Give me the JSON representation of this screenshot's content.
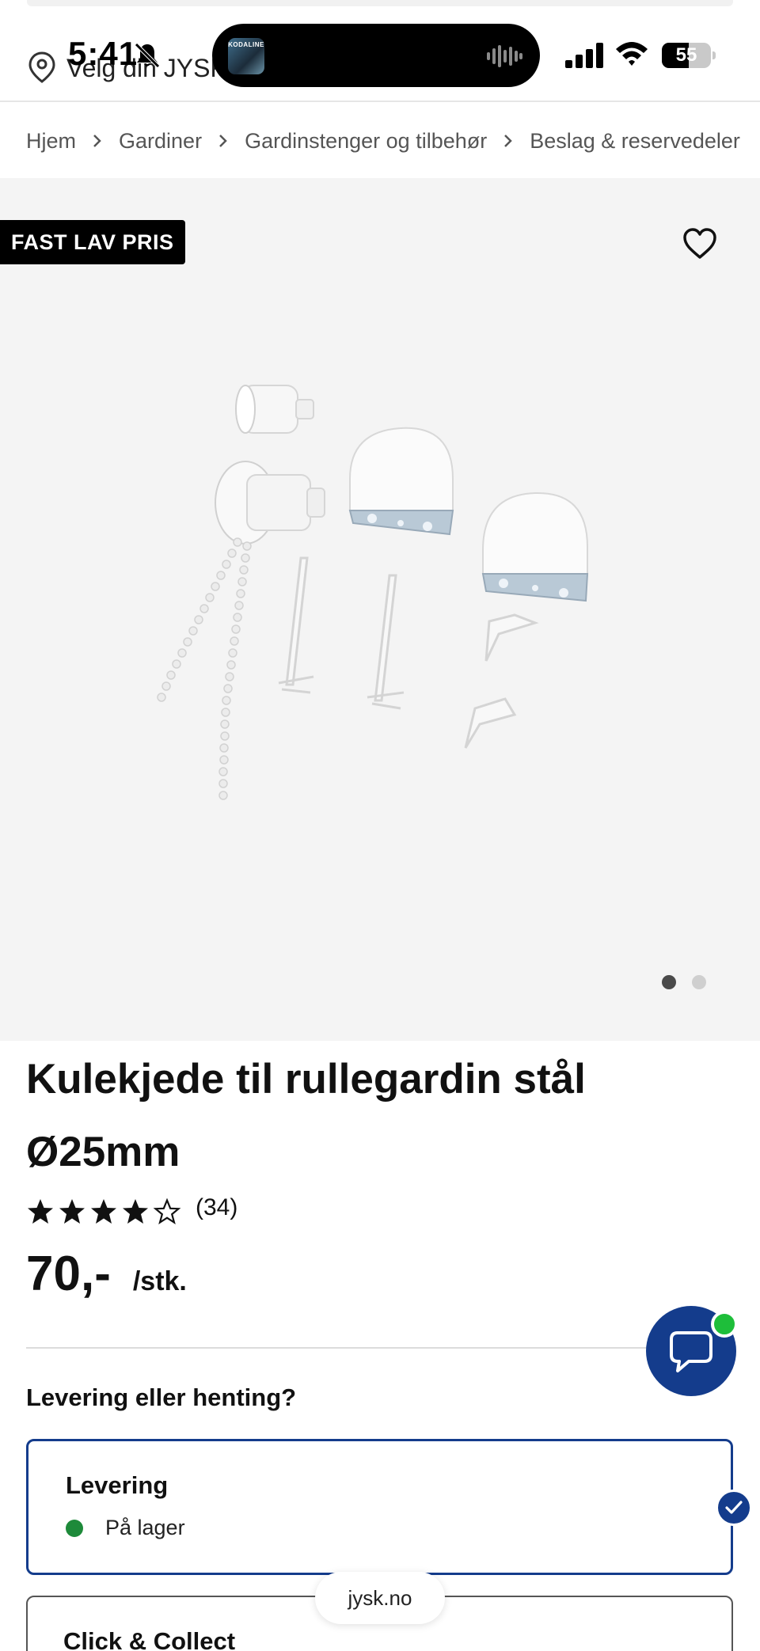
{
  "status_bar": {
    "time": "5:41",
    "battery": "55",
    "battery_level": 0.55,
    "now_playing_art_text": "KODALINE"
  },
  "header": {
    "location_text": "Velg din JYSK"
  },
  "breadcrumb": [
    "Hjem",
    "Gardiner",
    "Gardinstenger og tilbehør",
    "Beslag & reservedeler"
  ],
  "gallery": {
    "badge": "FAST LAV PRIS",
    "image_count": 2,
    "active_image": 1
  },
  "product": {
    "title": "Kulekjede til rullegardin stål Ø25mm",
    "rating": 4,
    "rating_max": 5,
    "rating_count": "(34)",
    "price": "70,-",
    "unit": "/stk."
  },
  "delivery": {
    "heading": "Levering eller henting?",
    "options": [
      {
        "title": "Levering",
        "stock": "På lager",
        "selected": true
      },
      {
        "title": "Click & Collect",
        "selected": false
      }
    ]
  },
  "browser": {
    "url": "jysk.no"
  },
  "colors": {
    "brand_blue": "#143c8c",
    "in_stock_green": "#1e8a3a",
    "chat_online": "#1ebe3a"
  }
}
